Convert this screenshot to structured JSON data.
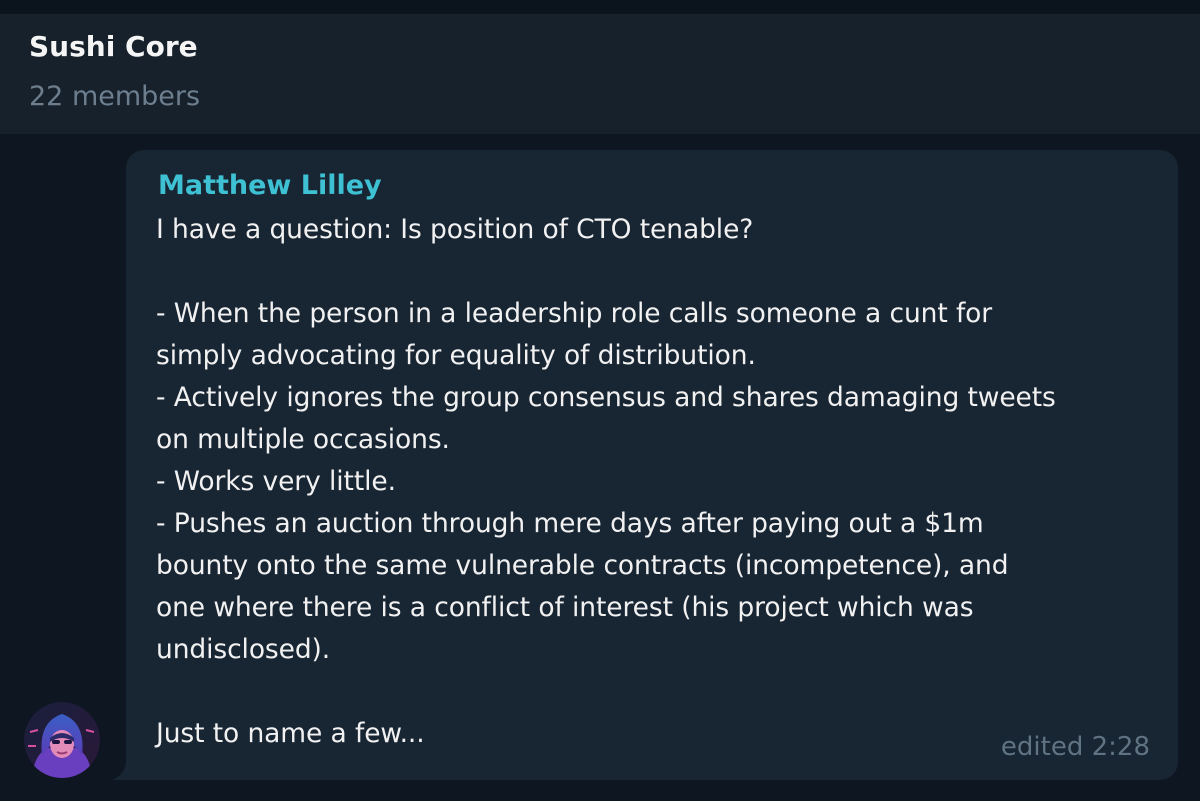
{
  "header": {
    "title": "Sushi Core",
    "subtitle": "22 members"
  },
  "message": {
    "sender": "Matthew Lilley",
    "lines": [
      "I have a question: Is position of CTO tenable?",
      "",
      "- When the person in a leadership role calls someone a cunt for",
      "simply advocating for equality of distribution.",
      "- Actively ignores the group consensus and shares damaging tweets",
      "on multiple occasions.",
      "- Works very little.",
      "- Pushes an auction through mere days after paying out a $1m",
      "bounty onto the same vulnerable contracts (incompetence), and",
      "one where there is a conflict of interest (his project which was",
      "undisclosed).",
      "",
      "Just to name a few..."
    ],
    "timestamp": "edited 2:28"
  },
  "avatar": {
    "icon": "user-avatar-hooded-figure",
    "colors": [
      "#2c4ea8",
      "#7a3ec9",
      "#d94fa0"
    ]
  }
}
